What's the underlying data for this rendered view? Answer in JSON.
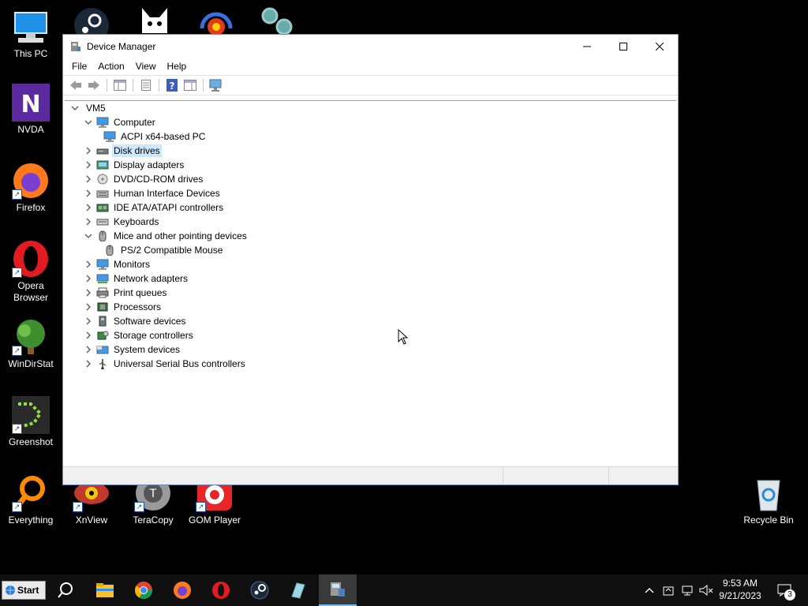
{
  "desktop": {
    "icons": [
      {
        "label": "This PC",
        "icon": "this-pc-icon"
      },
      {
        "label": "NVDA",
        "icon": "nvda-icon"
      },
      {
        "label": "Firefox",
        "icon": "firefox-icon"
      },
      {
        "label": "Opera Browser",
        "icon": "opera-icon"
      },
      {
        "label": "WinDirStat",
        "icon": "windirstat-icon"
      },
      {
        "label": "Greenshot",
        "icon": "greenshot-icon"
      },
      {
        "label": "Everything",
        "icon": "everything-icon"
      },
      {
        "label": "XnView",
        "icon": "xnview-icon"
      },
      {
        "label": "TeraCopy",
        "icon": "teracopy-icon"
      },
      {
        "label": "GOM Player",
        "icon": "gom-player-icon"
      },
      {
        "label": "Recycle Bin",
        "icon": "recycle-bin-icon"
      }
    ]
  },
  "window": {
    "title": "Device Manager",
    "menu": [
      "File",
      "Action",
      "View",
      "Help"
    ],
    "tree": [
      {
        "label": "VM5",
        "level": 0,
        "expander": "expanded",
        "icon": "none"
      },
      {
        "label": "Computer",
        "level": 1,
        "expander": "expanded",
        "icon": "monitor-icon"
      },
      {
        "label": "ACPI x64-based PC",
        "level": 2,
        "expander": "none",
        "icon": "monitor-icon"
      },
      {
        "label": "Disk drives",
        "level": 1,
        "expander": "collapsed",
        "icon": "disk-drive-icon",
        "selected": true
      },
      {
        "label": "Display adapters",
        "level": 1,
        "expander": "collapsed",
        "icon": "display-adapter-icon"
      },
      {
        "label": "DVD/CD-ROM drives",
        "level": 1,
        "expander": "collapsed",
        "icon": "dvd-icon"
      },
      {
        "label": "Human Interface Devices",
        "level": 1,
        "expander": "collapsed",
        "icon": "hid-icon"
      },
      {
        "label": "IDE ATA/ATAPI controllers",
        "level": 1,
        "expander": "collapsed",
        "icon": "ide-controller-icon"
      },
      {
        "label": "Keyboards",
        "level": 1,
        "expander": "collapsed",
        "icon": "keyboard-icon"
      },
      {
        "label": "Mice and other pointing devices",
        "level": 1,
        "expander": "expanded",
        "icon": "mouse-icon"
      },
      {
        "label": "PS/2 Compatible Mouse",
        "level": 2,
        "expander": "none",
        "icon": "mouse-icon"
      },
      {
        "label": "Monitors",
        "level": 1,
        "expander": "collapsed",
        "icon": "monitor-icon"
      },
      {
        "label": "Network adapters",
        "level": 1,
        "expander": "collapsed",
        "icon": "network-adapter-icon"
      },
      {
        "label": "Print queues",
        "level": 1,
        "expander": "collapsed",
        "icon": "printer-icon"
      },
      {
        "label": "Processors",
        "level": 1,
        "expander": "collapsed",
        "icon": "processor-icon"
      },
      {
        "label": "Software devices",
        "level": 1,
        "expander": "collapsed",
        "icon": "software-device-icon"
      },
      {
        "label": "Storage controllers",
        "level": 1,
        "expander": "collapsed",
        "icon": "storage-controller-icon"
      },
      {
        "label": "System devices",
        "level": 1,
        "expander": "collapsed",
        "icon": "system-devices-icon"
      },
      {
        "label": "Universal Serial Bus controllers",
        "level": 1,
        "expander": "collapsed",
        "icon": "usb-icon"
      }
    ]
  },
  "taskbar": {
    "start_label": "Start",
    "apps": [
      "search-icon",
      "file-explorer-icon",
      "chrome-icon",
      "firefox-icon",
      "opera-icon",
      "steam-icon",
      "app-icon",
      "device-manager-icon"
    ],
    "time": "9:53 AM",
    "date": "9/21/2023",
    "notification_count": "3"
  },
  "colors": {
    "accent": "#0078d7",
    "selection": "#cce8ff"
  }
}
